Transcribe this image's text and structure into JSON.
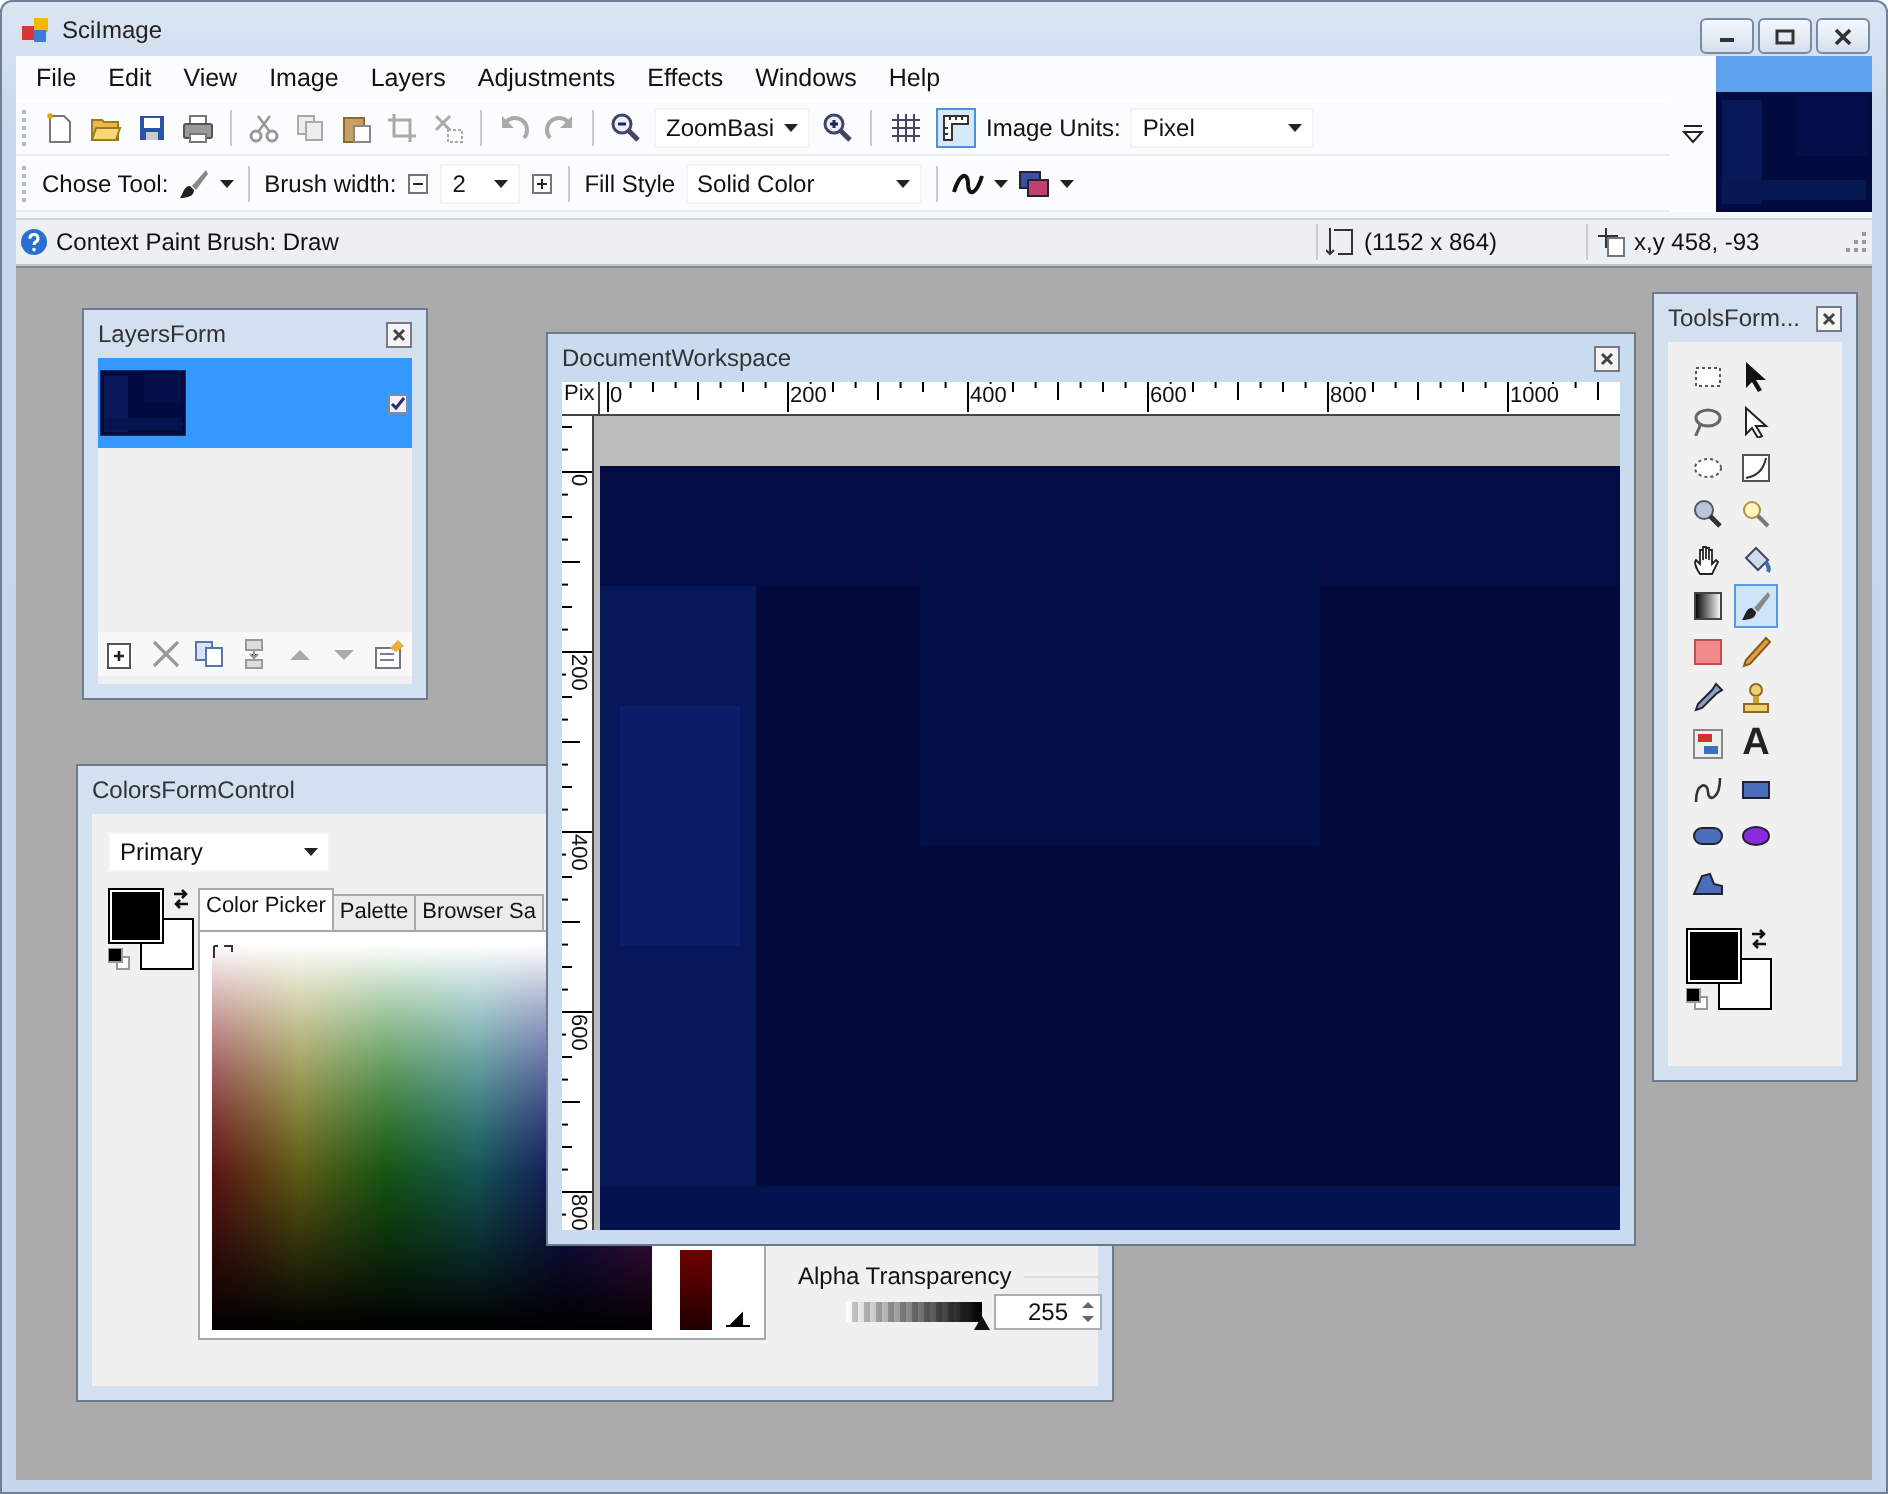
{
  "window": {
    "title": "SciImage"
  },
  "menu": [
    {
      "label": "File"
    },
    {
      "label": "Edit"
    },
    {
      "label": "View"
    },
    {
      "label": "Image"
    },
    {
      "label": "Layers"
    },
    {
      "label": "Adjustments"
    },
    {
      "label": "Effects"
    },
    {
      "label": "Windows"
    },
    {
      "label": "Help"
    }
  ],
  "main_toolbar": {
    "zoom_value": "ZoomBasi",
    "units_label": "Image Units:",
    "units_value": "Pixel",
    "grid_on": false,
    "rulers_on": true
  },
  "tool_toolbar": {
    "tool_label": "Chose Tool:",
    "brush_label": "Brush width:",
    "brush_value": "2",
    "fill_label": "Fill Style",
    "fill_value": "Solid Color"
  },
  "status_bar": {
    "message": "Context Paint Brush: Draw",
    "image_size": "(1152 x 864)",
    "cursor": "x,y 458, -93"
  },
  "layers_form": {
    "title": "LayersForm",
    "layers": [
      {
        "selected": true,
        "visible": true
      }
    ]
  },
  "colors_form": {
    "title": "ColorsFormControl",
    "target": "Primary",
    "tabs": [
      {
        "label": "Color Picker",
        "selected": true
      },
      {
        "label": "Palette",
        "selected": false
      },
      {
        "label": "Browser Sa",
        "selected": false
      }
    ],
    "alpha": {
      "label": "Alpha Transparency",
      "value": "255",
      "level": 1
    }
  },
  "document": {
    "title": "DocumentWorkspace",
    "unit": "Pix",
    "h_ticks": [
      "0",
      "200",
      "400",
      "600",
      "800",
      "1000"
    ],
    "v_ticks": [
      "0",
      "200",
      "400",
      "600",
      "800"
    ]
  },
  "tools_form": {
    "title": "ToolsForm...",
    "tools": [
      {
        "selected": false
      },
      {
        "selected": false
      },
      {
        "selected": false
      },
      {
        "selected": false
      },
      {
        "selected": false
      },
      {
        "selected": false
      },
      {
        "selected": false
      },
      {
        "selected": false
      },
      {
        "selected": false
      },
      {
        "selected": false
      },
      {
        "selected": false
      },
      {
        "selected": true
      },
      {
        "selected": false
      },
      {
        "selected": false
      },
      {
        "selected": false
      },
      {
        "selected": false
      },
      {
        "selected": false
      },
      {
        "selected": false,
        "glyph": "A"
      },
      {
        "selected": false
      },
      {
        "selected": false
      },
      {
        "selected": false
      },
      {
        "selected": false
      },
      {
        "selected": false
      }
    ]
  }
}
